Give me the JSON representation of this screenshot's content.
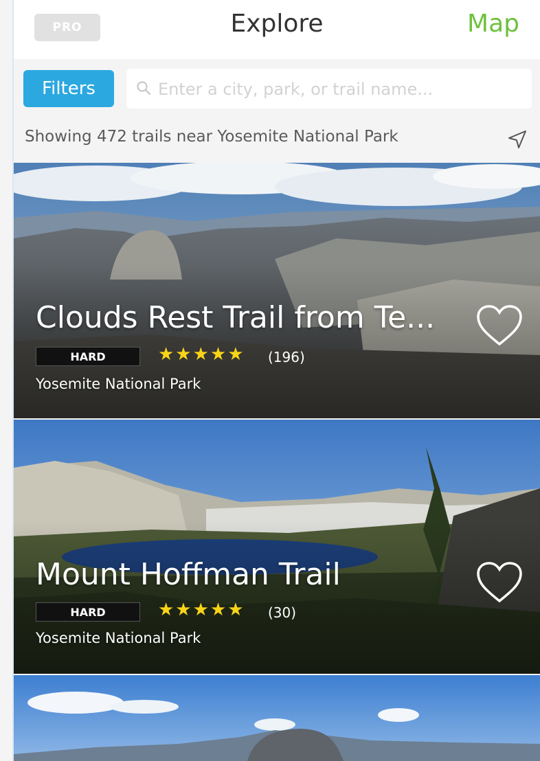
{
  "header": {
    "pro_label": "PRO",
    "title": "Explore",
    "map_label": "Map"
  },
  "search": {
    "filters_label": "Filters",
    "placeholder": "Enter a city, park, or trail name...",
    "value": ""
  },
  "status": {
    "text": "Showing 472 trails near Yosemite National Park"
  },
  "trails": [
    {
      "name": "Clouds Rest Trail from Te...",
      "difficulty": "HARD",
      "stars": "★★★★★",
      "rating": 5,
      "reviews": "(196)",
      "park": "Yosemite National Park",
      "favorite": false
    },
    {
      "name": "Mount Hoffman Trail",
      "difficulty": "HARD",
      "stars": "★★★★★",
      "rating": 5,
      "reviews": "(30)",
      "park": "Yosemite National Park",
      "favorite": false
    }
  ],
  "colors": {
    "accent_blue": "#2ba8e0",
    "map_green": "#6ec13c",
    "star_yellow": "#f7d418"
  },
  "icons": {
    "search": "search-icon",
    "locate": "location-arrow-icon",
    "favorite": "heart-icon"
  }
}
